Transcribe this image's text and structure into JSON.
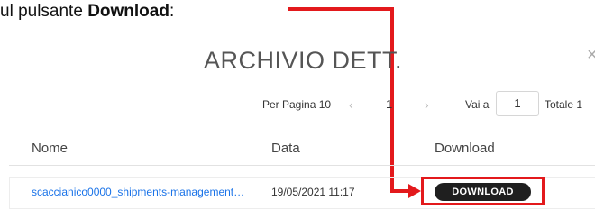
{
  "instruction": {
    "prefix": "ul pulsante ",
    "bold": "Download",
    "suffix": ":"
  },
  "dialog": {
    "title": "ARCHIVIO DETT.",
    "close_glyph": "×"
  },
  "pagination": {
    "per_page_label": "Per Pagina 10",
    "prev_glyph": "‹",
    "current_page": "1",
    "next_glyph": "›",
    "goto_label": "Vai a",
    "goto_value": "1",
    "total_label": "Totale 1"
  },
  "table": {
    "columns": [
      "Nome",
      "Data",
      "Download"
    ],
    "rows": [
      {
        "name": "scaccianico0000_shipments-management…",
        "date": "19/05/2021 11:17",
        "action": "DOWNLOAD"
      }
    ]
  },
  "colors": {
    "annotation": "#e3191c",
    "link": "#1a73e8",
    "button_bg": "#1f1f1f"
  },
  "icons": {
    "close": "close-icon",
    "prev": "chevron-left-icon",
    "next": "chevron-right-icon",
    "arrow": "arrow-annotation-icon"
  }
}
